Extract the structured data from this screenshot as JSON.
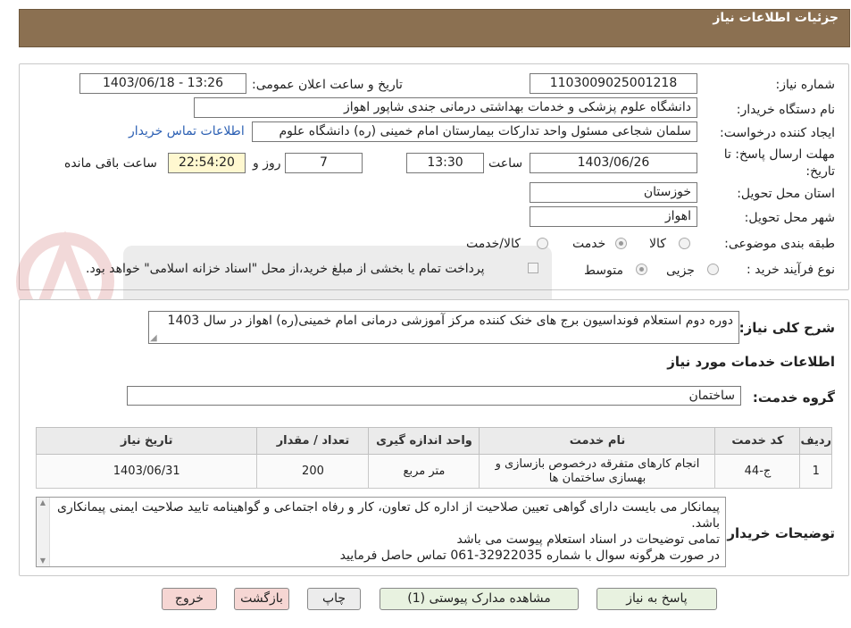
{
  "header": {
    "title": "جزئیات اطلاعات نیاز"
  },
  "fields": {
    "need_number_label": "شماره نیاز:",
    "need_number": "1103009025001218",
    "announce_label": "تاریخ و ساعت اعلان عمومی:",
    "announce_value": "1403/06/18 - 13:26",
    "buyer_org_label": "نام دستگاه خریدار:",
    "buyer_org": "دانشگاه علوم پزشکی و خدمات بهداشتی درمانی جندی شاپور اهواز",
    "creator_label": "ایجاد کننده درخواست:",
    "creator": "سلمان شجاعی مسئول واحد تدارکات بیمارستان امام خمینی (ره) دانشگاه علوم",
    "contact_link": "اطلاعات تماس خریدار",
    "deadline_label_1": "مهلت ارسال پاسخ: تا",
    "deadline_label_2": "تاریخ:",
    "deadline_date": "1403/06/26",
    "time_label": "ساعت",
    "deadline_time": "13:30",
    "days_value": "7",
    "days_label": "روز و",
    "remaining_time": "22:54:20",
    "remaining_label": "ساعت باقی مانده",
    "province_label": "استان محل تحویل:",
    "province": "خوزستان",
    "city_label": "شهر محل تحویل:",
    "city": "اهواز",
    "category_label": "طبقه بندی موضوعی:",
    "category_options": [
      "کالا",
      "خدمت",
      "کالا/خدمت"
    ],
    "category_selected": "خدمت",
    "process_label": "نوع فرآیند خرید :",
    "process_options": [
      "جزیی",
      "متوسط"
    ],
    "process_selected": "متوسط",
    "payment_note": "پرداخت تمام یا بخشی از مبلغ خرید،از محل \"اسناد خزانه اسلامی\" خواهد بود."
  },
  "summary": {
    "label": "شرح کلی نیاز:",
    "value": "دوره دوم استعلام فونداسیون برج های خنک کننده مرکز آموزشی درمانی امام خمینی(ره) اهواز در سال 1403"
  },
  "services": {
    "section_title": "اطلاعات خدمات مورد نیاز",
    "group_label": "گروه خدمت:",
    "group_value": "ساختمان",
    "columns": [
      "ردیف",
      "کد خدمت",
      "نام خدمت",
      "واحد اندازه گیری",
      "تعداد / مقدار",
      "تاریخ نیاز"
    ],
    "rows": [
      [
        "1",
        "ج-44",
        "انجام کارهای متفرقه درخصوص بازسازی و بهسازی ساختمان ها",
        "متر مربع",
        "200",
        "1403/06/31"
      ]
    ]
  },
  "buyer_notes": {
    "label": "توضیحات خریدار:",
    "lines": [
      "پیمانکار می بایست دارای گواهی تعیین صلاحیت از اداره کل تعاون، کار و رفاه اجتماعی و گواهینامه تایید صلاحیت ایمنی پیمانکاری باشد.",
      "تمامی توضیحات در اسناد استعلام پیوست می باشد",
      "در صورت هرگونه سوال با شماره  32922035-061 تماس حاصل فرمایید"
    ]
  },
  "buttons": {
    "reply": "پاسخ به نیاز",
    "attachments": "مشاهده مدارک پیوستی (1)",
    "print": "چاپ",
    "back": "بازگشت",
    "exit": "خروج"
  },
  "colors": {
    "header_bg": "#8b7051",
    "link": "#2b5fb3",
    "highlight": "#fff8d0"
  }
}
